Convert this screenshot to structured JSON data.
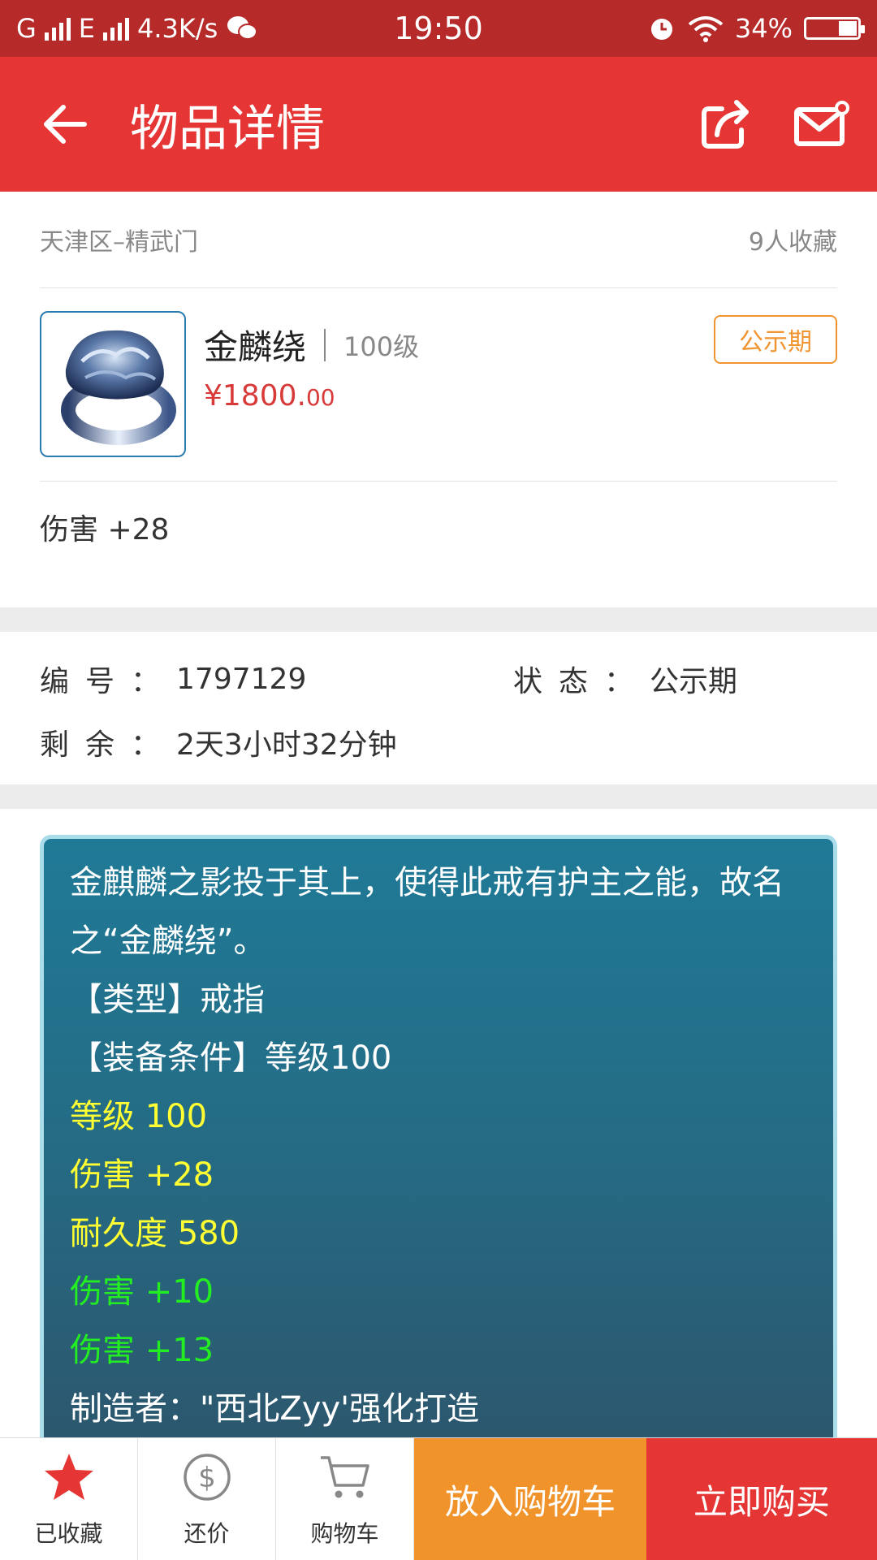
{
  "status_bar": {
    "carrier1": "G",
    "carrier2": "E",
    "speed": "4.3K/s",
    "time": "19:50",
    "battery": "34%",
    "battery_level": 0.34
  },
  "app_bar": {
    "title": "物品详情"
  },
  "item": {
    "server": "天津区–精武门",
    "favorites": "9人收藏",
    "name": "金麟绕",
    "level": "100级",
    "price_main": "¥1800.",
    "price_cents": "00",
    "badge": "公示期",
    "attribute": "伤害 +28"
  },
  "details": {
    "id_label": "编号：",
    "id_value": "1797129",
    "status_label": "状态：",
    "status_value": "公示期",
    "remain_label": "剩余：",
    "remain_value": "2天3小时32分钟"
  },
  "description": {
    "intro": "金麒麟之影投于其上，使得此戒有护主之能，故名之“金麟绕”。",
    "type": "【类型】戒指",
    "requirement": "【装备条件】等级100",
    "yellow_lines": [
      "等级 100",
      "伤害 +28",
      "耐久度 580"
    ],
    "green_lines": [
      "伤害 +10",
      "伤害 +13"
    ],
    "maker": "制造者：\"西北Zyy'强化打造"
  },
  "bottom_bar": {
    "favorite_label": "已收藏",
    "bargain_label": "还价",
    "cart_label": "购物车",
    "add_to_cart": "放入购物车",
    "buy_now": "立即购买"
  },
  "colors": {
    "primary_red": "#e53535",
    "status_red": "#b72a2a",
    "orange": "#f0932b",
    "price_red": "#d83a3a",
    "desc_bg": "#256b84",
    "attr_yellow": "#ffff33",
    "attr_green": "#22ee22"
  },
  "icons": {
    "back": "arrow-left-icon",
    "share": "share-icon",
    "message": "mail-icon",
    "favorite": "star-icon",
    "bargain": "dollar-circle-icon",
    "cart": "cart-icon"
  }
}
